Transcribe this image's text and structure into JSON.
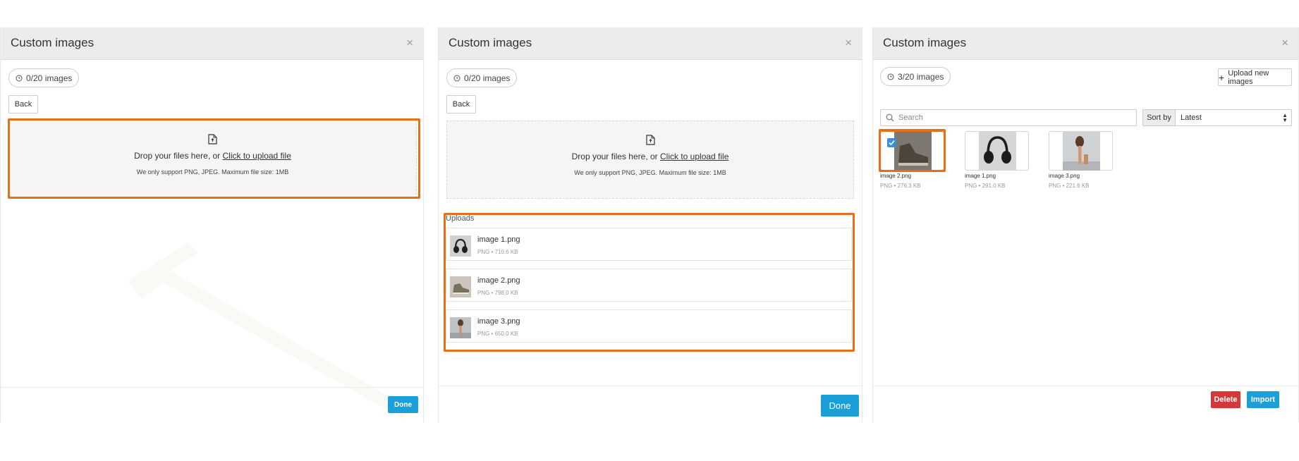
{
  "panels": {
    "left": {
      "title": "Custom images",
      "close": "×",
      "count": "0/20 images",
      "back": "Back",
      "drop_text": "Drop your files here, or ",
      "drop_link": "Click to upload file",
      "drop_note": "We only support PNG, JPEG. Maximum file size: 1MB",
      "done": "Done"
    },
    "middle": {
      "title": "Custom images",
      "close": "×",
      "count": "0/20 images",
      "back": "Back",
      "drop_text": "Drop your files here, or ",
      "drop_link": "Click to upload file",
      "drop_note": "We only support PNG, JPEG. Maximum file size: 1MB",
      "uploads_label": "Uploads",
      "uploads": [
        {
          "name": "image 1.png",
          "meta": "PNG • 710.6 KB"
        },
        {
          "name": "image 2.png",
          "meta": "PNG • 798.0 KB"
        },
        {
          "name": "image 3.png",
          "meta": "PNG • 650.0 KB"
        }
      ],
      "done": "Done"
    },
    "right": {
      "title": "Custom images",
      "close": "×",
      "count": "3/20 images",
      "upload_new": "Upload new images",
      "search_placeholder": "Search",
      "sort_label": "Sort by",
      "sort_value": "Latest",
      "gallery": [
        {
          "name": "image 2.png",
          "meta": "PNG • 276.3 KB",
          "selected": true
        },
        {
          "name": "image 1.png",
          "meta": "PNG • 291.0 KB",
          "selected": false
        },
        {
          "name": "image 3.png",
          "meta": "PNG • 221.6 KB",
          "selected": false
        }
      ],
      "delete": "Delete",
      "import": "Import"
    }
  },
  "colors": {
    "highlight": "#e66f1c",
    "primary": "#1a9fd8",
    "danger": "#d83737",
    "header_bg": "#ececec"
  }
}
